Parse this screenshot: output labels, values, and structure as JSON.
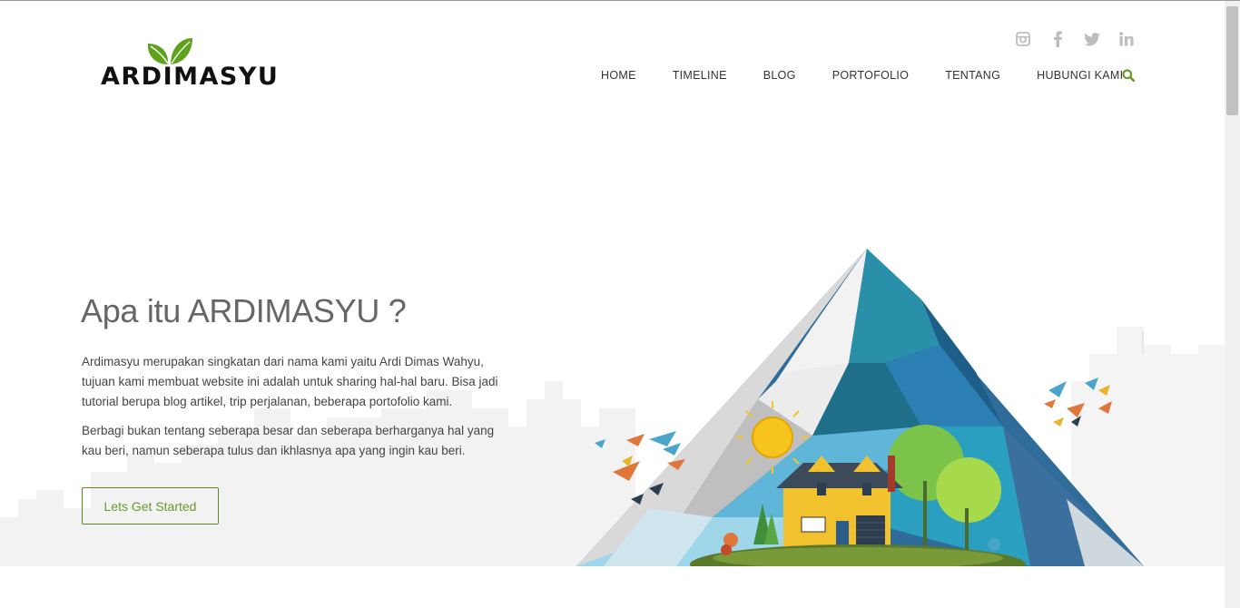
{
  "brand": {
    "name": "ARDIMASYU"
  },
  "social": [
    "instagram-icon",
    "facebook-icon",
    "twitter-icon",
    "linkedin-icon"
  ],
  "nav": {
    "items": [
      "HOME",
      "TIMELINE",
      "BLOG",
      "PORTOFOLIO",
      "TENTANG",
      "HUBUNGI KAMI"
    ],
    "search_icon": "search-icon"
  },
  "hero": {
    "title": "Apa itu ARDIMASYU ?",
    "paragraph1": "Ardimasyu merupakan singkatan dari nama kami yaitu Ardi Dimas Wahyu, tujuan kami membuat website ini adalah untuk sharing hal-hal baru. Bisa jadi tutorial berupa blog artikel, trip perjalanan, beberapa portofolio kami.",
    "paragraph2": "Berbagi bukan tentang seberapa besar dan seberapa berharganya hal yang kau beri, namun seberapa tulus dan ikhlasnya apa yang ingin kau beri.",
    "cta_label": "Lets Get Started"
  },
  "colors": {
    "accent": "#6a9a2e",
    "leaf": "#5ea21e",
    "text": "#333333",
    "skyline": "#f0f0f0"
  }
}
